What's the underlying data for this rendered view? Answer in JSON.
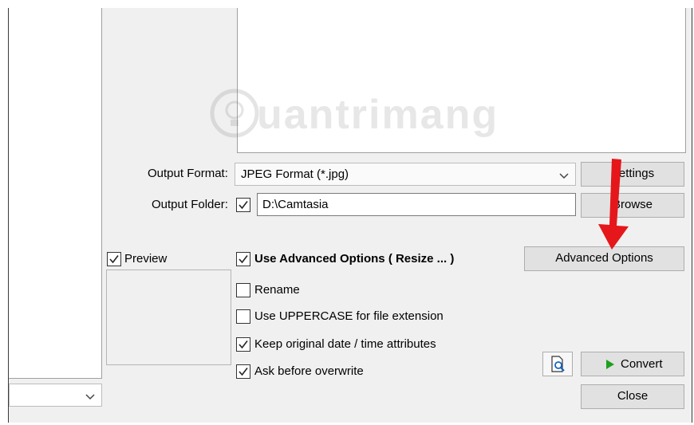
{
  "watermark": "uantrimang",
  "output": {
    "format_label": "Output Format:",
    "format_value": "JPEG Format (*.jpg)",
    "settings_label": "Settings",
    "folder_label": "Output Folder:",
    "folder_checked": true,
    "folder_value": "D:\\Camtasia",
    "browse_label": "Browse"
  },
  "preview": {
    "label": "Preview",
    "checked": true
  },
  "options": {
    "advanced": {
      "label": "Use Advanced Options ( Resize ... )",
      "checked": true
    },
    "rename": {
      "label": "Rename",
      "checked": false
    },
    "uppercase": {
      "label": "Use UPPERCASE for file extension",
      "checked": false
    },
    "keep_date": {
      "label": "Keep original date / time attributes",
      "checked": true
    },
    "ask_overwrite": {
      "label": "Ask before overwrite",
      "checked": true
    }
  },
  "buttons": {
    "advanced_options": "Advanced Options",
    "convert": "Convert",
    "close": "Close"
  },
  "colors": {
    "arrow": "#e5171b",
    "convert_icon": "#1ea01e"
  }
}
